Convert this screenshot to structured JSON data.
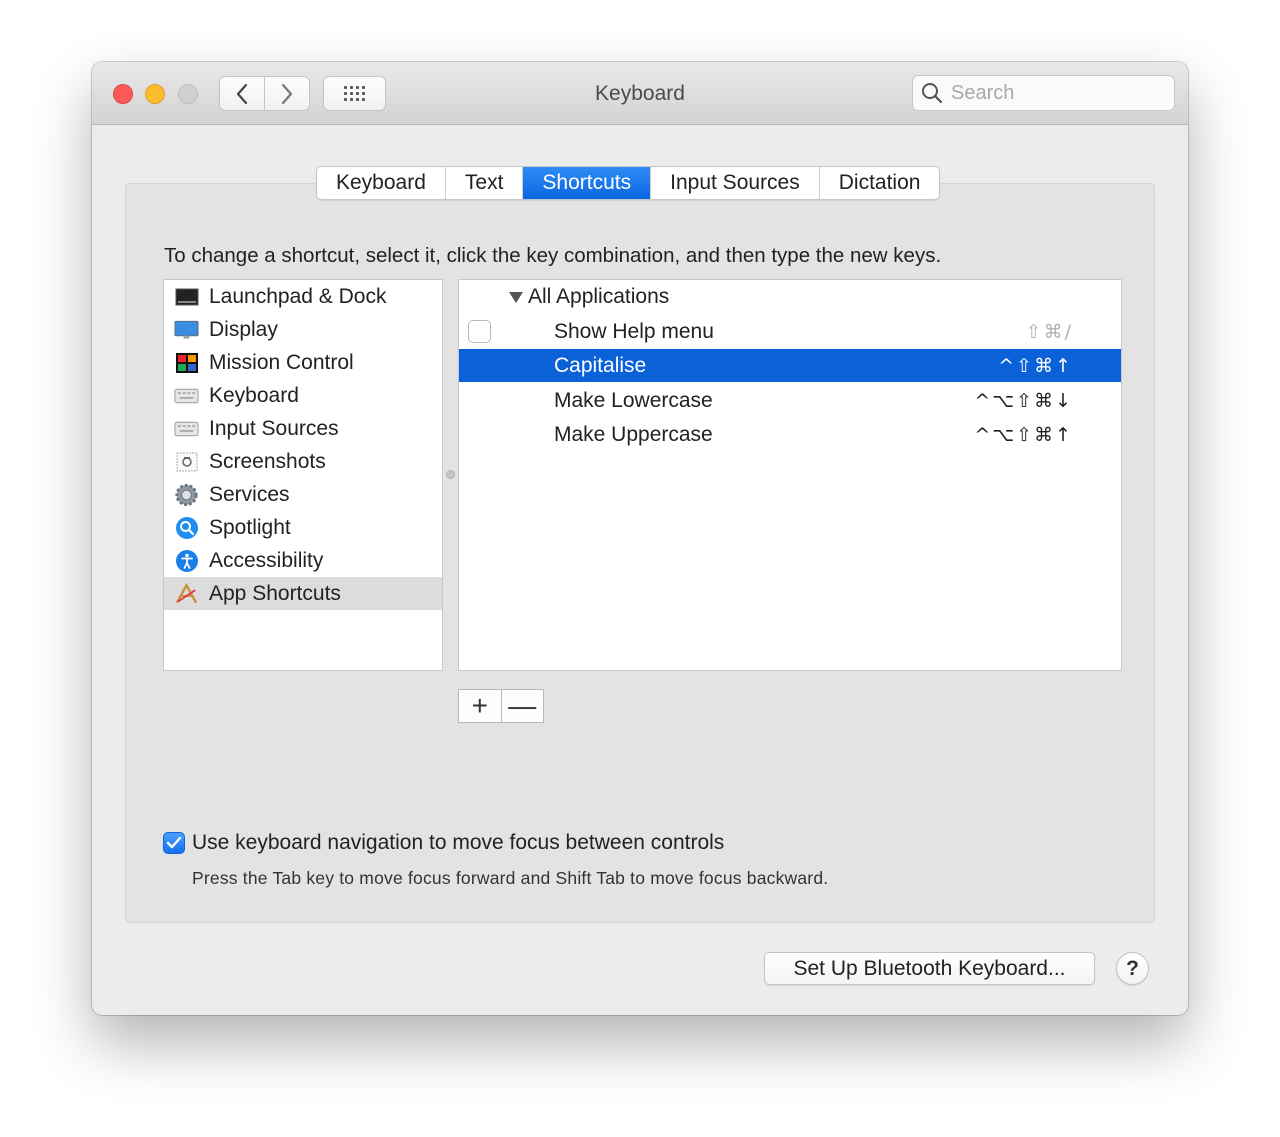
{
  "window": {
    "title": "Keyboard"
  },
  "search": {
    "placeholder": "Search"
  },
  "tabs": [
    {
      "label": "Keyboard",
      "active": false
    },
    {
      "label": "Text",
      "active": false
    },
    {
      "label": "Shortcuts",
      "active": true
    },
    {
      "label": "Input Sources",
      "active": false
    },
    {
      "label": "Dictation",
      "active": false
    }
  ],
  "instructions": "To change a shortcut, select it, click the key combination, and then type the new keys.",
  "categories": [
    {
      "label": "Launchpad & Dock",
      "icon": "launchpad-dock-icon"
    },
    {
      "label": "Display",
      "icon": "display-icon"
    },
    {
      "label": "Mission Control",
      "icon": "mission-control-icon"
    },
    {
      "label": "Keyboard",
      "icon": "keyboard-icon"
    },
    {
      "label": "Input Sources",
      "icon": "input-sources-icon"
    },
    {
      "label": "Screenshots",
      "icon": "screenshots-icon"
    },
    {
      "label": "Services",
      "icon": "services-gear-icon"
    },
    {
      "label": "Spotlight",
      "icon": "spotlight-icon"
    },
    {
      "label": "Accessibility",
      "icon": "accessibility-icon"
    },
    {
      "label": "App Shortcuts",
      "icon": "app-shortcuts-icon",
      "selected": true
    }
  ],
  "shortcuts": {
    "group": "All Applications",
    "rows": [
      {
        "name": "Show Help menu",
        "keys": "⇧⌘/",
        "dim": true,
        "checkbox": true
      },
      {
        "name": "Capitalise",
        "keys": "^⇧⌘↑",
        "selected": true
      },
      {
        "name": "Make Lowercase",
        "keys": "^⌥⇧⌘↓"
      },
      {
        "name": "Make Uppercase",
        "keys": "^⌥⇧⌘↑"
      }
    ]
  },
  "buttons": {
    "add": "+",
    "remove": "—",
    "bluetooth": "Set Up Bluetooth Keyboard...",
    "help": "?"
  },
  "keyboard_nav": {
    "checked": true,
    "label": "Use keyboard navigation to move focus between controls",
    "hint": "Press the Tab key to move focus forward and Shift Tab to move focus backward."
  },
  "colors": {
    "accent": "#0b61d8",
    "tab_active": "#1a78ea"
  }
}
